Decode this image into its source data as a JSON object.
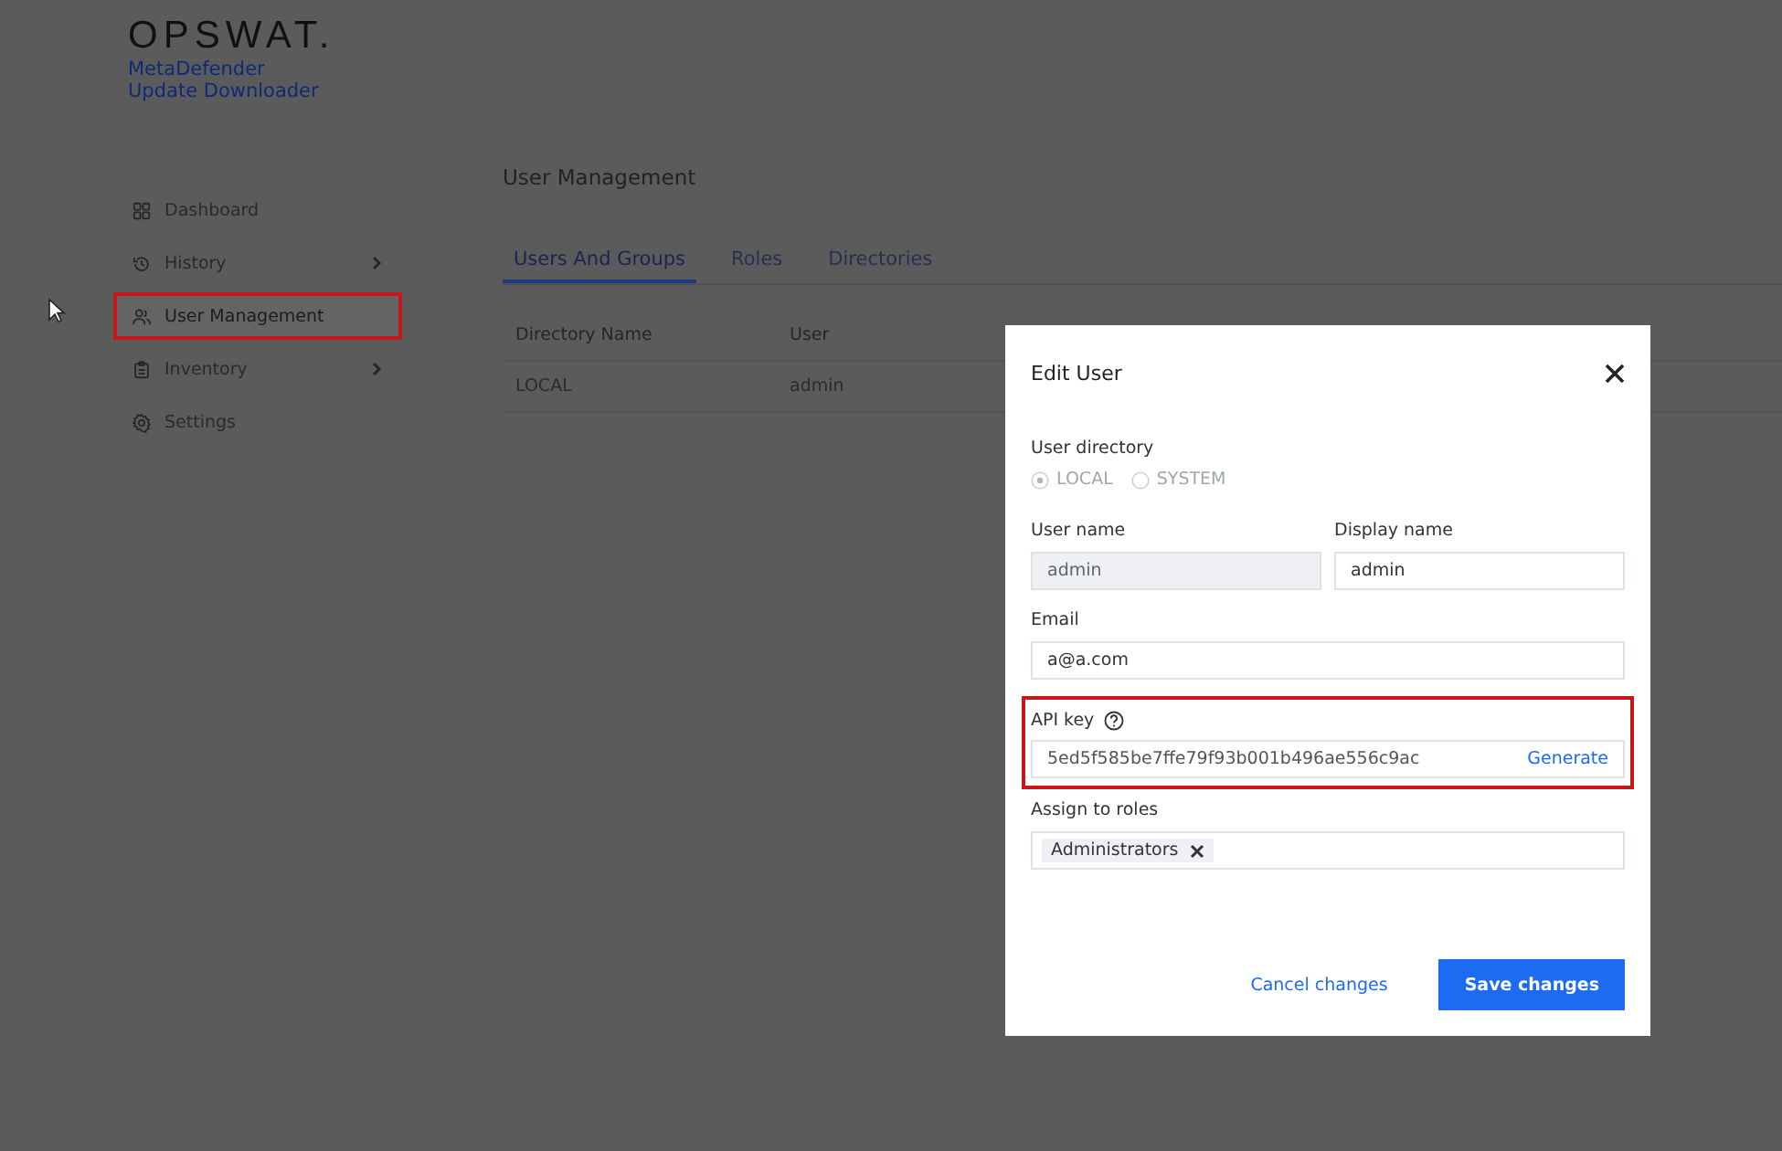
{
  "logo": {
    "wordmark": "OPSWAT.",
    "product_lines": [
      "MetaDefender",
      "Update Downloader"
    ]
  },
  "sidebar": {
    "items": [
      {
        "label": "Dashboard",
        "has_submenu": false,
        "selected": false,
        "highlighted": false
      },
      {
        "label": "History",
        "has_submenu": true,
        "selected": false,
        "highlighted": false
      },
      {
        "label": "User Management",
        "has_submenu": false,
        "selected": true,
        "highlighted": true
      },
      {
        "label": "Inventory",
        "has_submenu": true,
        "selected": false,
        "highlighted": false
      },
      {
        "label": "Settings",
        "has_submenu": false,
        "selected": false,
        "highlighted": false
      }
    ]
  },
  "main": {
    "title": "User Management",
    "tabs": [
      {
        "label": "Users And Groups",
        "selected": true
      },
      {
        "label": "Roles",
        "selected": false
      },
      {
        "label": "Directories",
        "selected": false
      }
    ],
    "table": {
      "columns": [
        "Directory Name",
        "User"
      ],
      "rows": [
        [
          "LOCAL",
          "admin"
        ]
      ]
    }
  },
  "dialog": {
    "title": "Edit User",
    "user_directory": {
      "label": "User directory",
      "disabled": true,
      "options": [
        {
          "label": "LOCAL",
          "selected": true
        },
        {
          "label": "SYSTEM",
          "selected": false
        }
      ]
    },
    "user_name": {
      "label": "User name",
      "value": "admin",
      "disabled": true
    },
    "display_name": {
      "label": "Display name",
      "value": "admin",
      "disabled": false
    },
    "email": {
      "label": "Email",
      "value": "a@a.com"
    },
    "api_key": {
      "label": "API key",
      "value": "5ed5f585be7ffe79f93b001b496ae556c9ac",
      "action": "Generate",
      "highlighted": true
    },
    "roles": {
      "label": "Assign to roles",
      "tags": [
        "Administrators"
      ]
    },
    "buttons": {
      "cancel": "Cancel changes",
      "save": "Save changes"
    }
  }
}
